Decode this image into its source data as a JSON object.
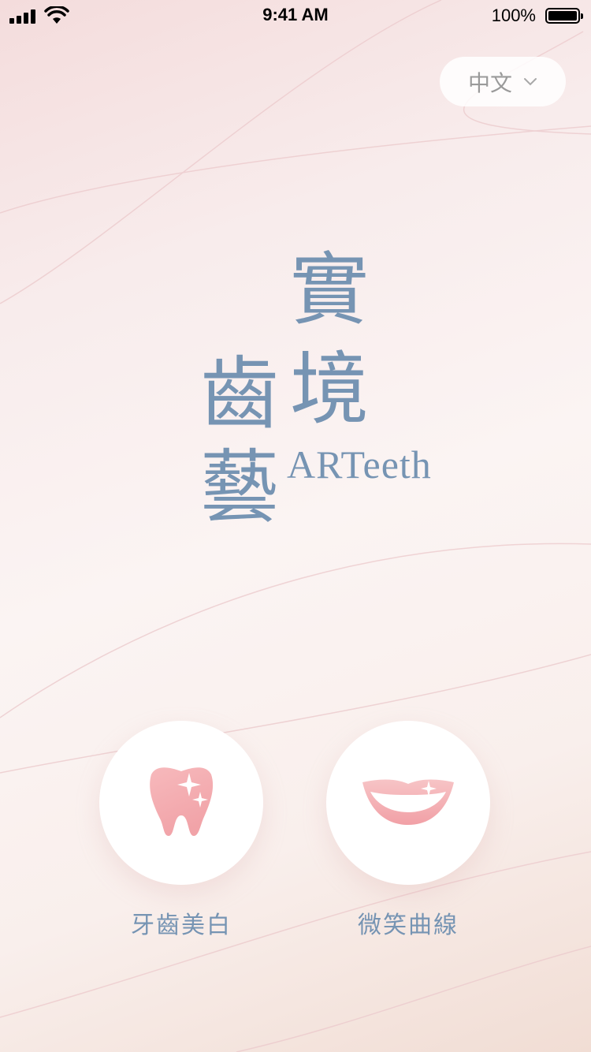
{
  "status_bar": {
    "time": "9:41 AM",
    "battery_percent": "100%",
    "battery_level": 1.0,
    "icons": [
      "signal-icon",
      "wifi-icon",
      "battery-icon"
    ]
  },
  "language_selector": {
    "label": "中文",
    "icon": "chevron-down-icon"
  },
  "logo": {
    "char_1": "實",
    "char_2": "境",
    "char_3": "齒",
    "char_4": "藝",
    "latin": "ARTeeth",
    "color": "#7694b3"
  },
  "features": [
    {
      "label": "牙齒美白",
      "icon": "sparkling-tooth-icon"
    },
    {
      "label": "微笑曲線",
      "icon": "smile-lips-icon"
    }
  ],
  "colors": {
    "accent": "#7694b3",
    "pink": "#f3a9ae"
  }
}
